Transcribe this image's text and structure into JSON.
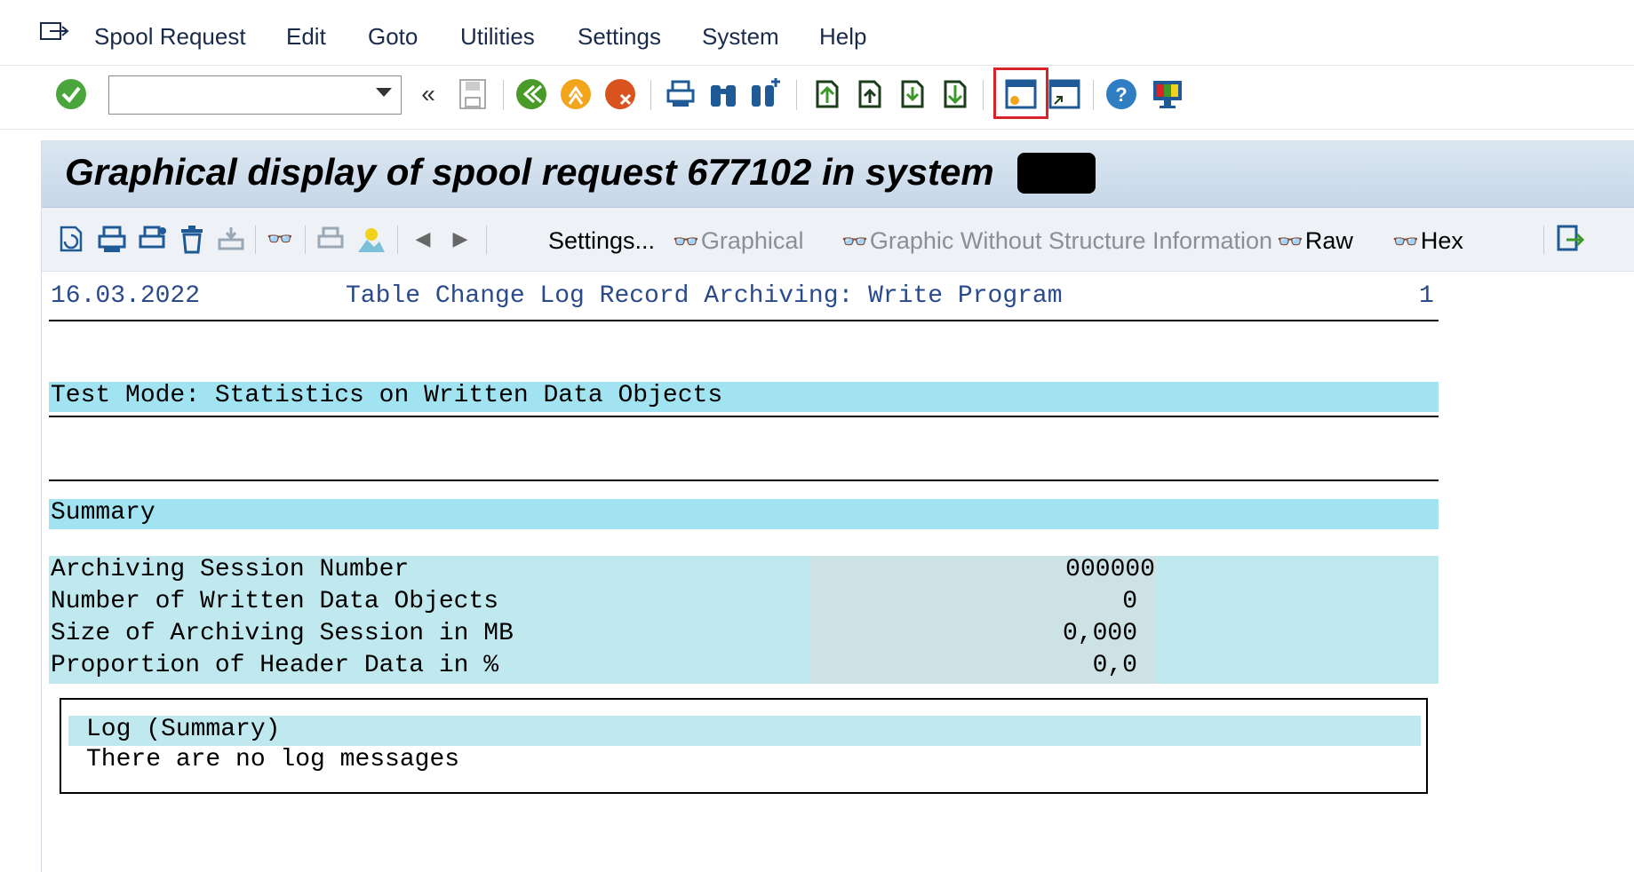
{
  "menu": {
    "items": [
      "Spool Request",
      "Edit",
      "Goto",
      "Utilities",
      "Settings",
      "System",
      "Help"
    ]
  },
  "toolbar": {
    "command_value": "",
    "icons": [
      "enter-icon",
      "back-double-icon",
      "save-icon",
      "back-icon",
      "exit-icon",
      "cancel-icon",
      "print-icon",
      "find-icon",
      "find-next-icon",
      "first-page-icon",
      "previous-page-icon",
      "next-page-icon",
      "last-page-icon",
      "create-session-icon",
      "shortcut-icon",
      "help-icon",
      "customize-layout-icon"
    ]
  },
  "window": {
    "title": "Graphical display of spool request 677102 in system"
  },
  "app_toolbar": {
    "settings_label": "Settings...",
    "graphical_label": "Graphical",
    "graphic_without_structure_label": "Graphic Without Structure Information",
    "raw_label": "Raw",
    "hex_label": "Hex"
  },
  "report": {
    "date": "16.03.2022",
    "program_title": "Table Change Log Record Archiving: Write Program",
    "page_number": "1",
    "test_mode_heading": "Test Mode: Statistics on Written Data Objects",
    "summary_heading": "Summary",
    "stats": [
      {
        "label": "Archiving Session Number",
        "value": "000000"
      },
      {
        "label": "Number of Written Data Objects",
        "value": "0"
      },
      {
        "label": "Size of Archiving Session in MB",
        "value": "0,000"
      },
      {
        "label": "Proportion of Header Data in %",
        "value": "0,0"
      }
    ],
    "log_heading": "Log (Summary)",
    "log_message": "There are no log messages"
  },
  "colors": {
    "highlight_band": "#a2e3f2",
    "stat_band": "#bfe9ee",
    "highlight_border": "#d9232a"
  }
}
